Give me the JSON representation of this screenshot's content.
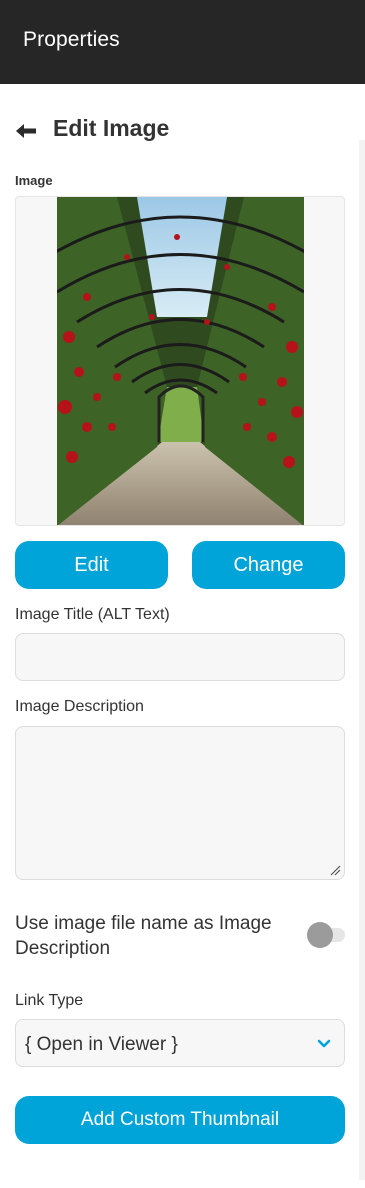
{
  "header": {
    "title": "Properties"
  },
  "page": {
    "heading": "Edit Image",
    "back_icon": "arrow-left-icon"
  },
  "image_section": {
    "label": "Image"
  },
  "buttons": {
    "edit_label": "Edit",
    "change_label": "Change",
    "thumbnail_label": "Add Custom Thumbnail"
  },
  "fields": {
    "title_label": "Image Title (ALT Text)",
    "title_value": "",
    "description_label": "Image Description",
    "description_value": "",
    "use_filename_label": "Use image file name as Image Description",
    "use_filename_enabled": false,
    "link_type_label": "Link Type",
    "link_type_value": "{ Open in Viewer }"
  },
  "colors": {
    "accent": "#00a4d9",
    "header_bg": "#262626",
    "text": "#333333"
  }
}
